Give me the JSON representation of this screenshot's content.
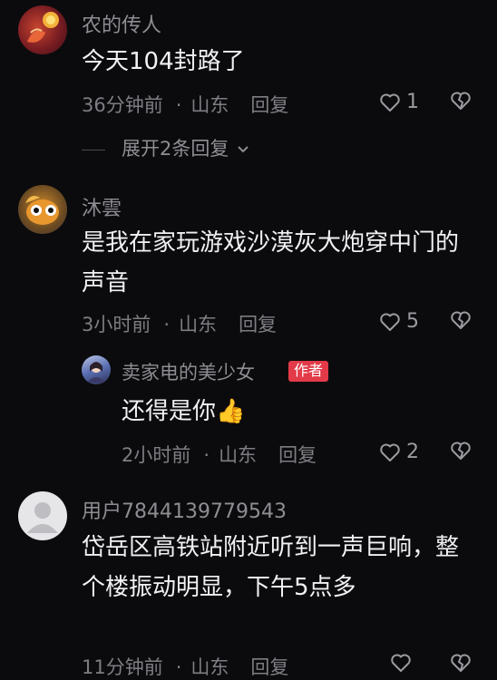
{
  "comments": [
    {
      "username": "农的传人",
      "text": "今天104封路了",
      "time": "36分钟前",
      "location": "山东",
      "reply": "回复",
      "likes": "1",
      "expand": "展开2条回复"
    },
    {
      "username": "沐雲",
      "text": "是我在家玩游戏沙漠灰大炮穿中门的声音",
      "time": "3小时前",
      "location": "山东",
      "reply": "回复",
      "likes": "5",
      "sub": {
        "username": "卖家电的美少女",
        "badge": "作者",
        "text": "还得是你👍",
        "time": "2小时前",
        "location": "山东",
        "reply": "回复",
        "likes": "2"
      }
    },
    {
      "username": "用户7844139779543",
      "text": "岱岳区高铁站附近听到一声巨响，整个楼振动明显，下午5点多",
      "time": "11分钟前",
      "location": "山东",
      "reply": "回复",
      "likes": ""
    }
  ],
  "separator": "·",
  "colors": {
    "background": "#0b0b0d",
    "badge": "#e23a48"
  }
}
